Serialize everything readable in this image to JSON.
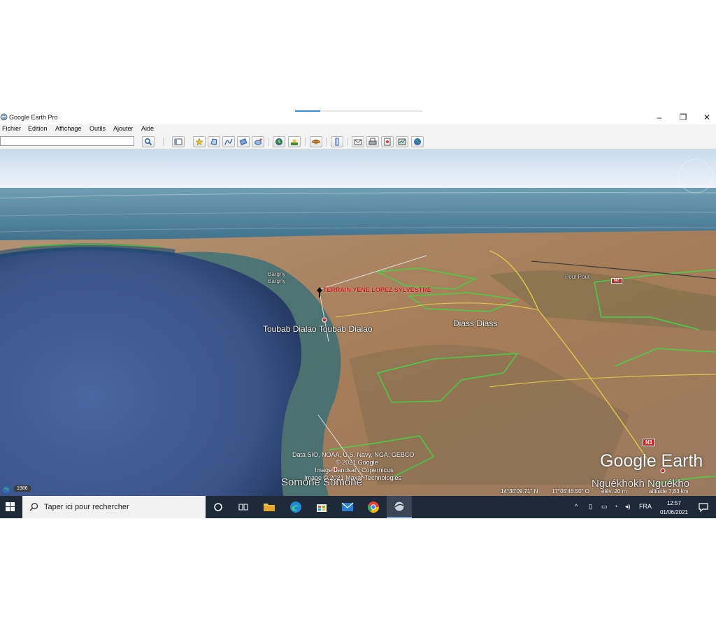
{
  "window": {
    "title": "Google Earth Pro",
    "loading_progress": 0.2,
    "controls": {
      "minimize": "–",
      "restore": "❐",
      "close": "✕"
    }
  },
  "menu": [
    "Fichier",
    "Edition",
    "Affichage",
    "Outils",
    "Ajouter",
    "Aide"
  ],
  "search": {
    "value": ""
  },
  "toolbar_icons": [
    "search-icon",
    "sidebar-toggle-icon",
    "placemark-icon",
    "polygon-icon",
    "path-icon",
    "overlay-icon",
    "record-tour-icon",
    "historical-imagery-icon",
    "sunlight-icon",
    "planets-icon",
    "ruler-icon",
    "email-icon",
    "print-icon",
    "save-image-icon",
    "view-in-maps-icon",
    "earth-icon"
  ],
  "map": {
    "placemark": {
      "label": "TERRAIN YENE LOPEZ SYLVESTRE",
      "color": "#c91616"
    },
    "places": {
      "bargny": "Bargny",
      "bargny2": "Bargny",
      "toubab": "Toubab Dialao  Toubab Dialao",
      "diass": "Diass  Diass",
      "somone": "Somone  Somone",
      "nguekhokh": "Nguékhokh  Nguékho",
      "pout": "Pout  Pout"
    },
    "road_shields": {
      "n1": "N1",
      "n2": "N2"
    },
    "credits": {
      "line1": "Data SIO, NOAA, U.S. Navy, NGA, GEBCO",
      "line2": "© 2021 Google",
      "line3": "Image Landsat / Copernicus",
      "line4": "Image © 2021 Maxar Technologies"
    },
    "brand": "Google Earth",
    "status": {
      "lat": "14°30'09.71\" N",
      "lon": "17°05'46.50\" O",
      "elev": "élév.   20 m",
      "alt": "altitude   7,83 km"
    },
    "imagery_year": "1986"
  },
  "taskbar": {
    "search_placeholder": "Taper ici pour rechercher",
    "apps": [
      "cortana-icon",
      "task-view-icon",
      "file-explorer-icon",
      "edge-icon",
      "store-icon",
      "mail-icon",
      "chrome-icon",
      "google-earth-icon"
    ],
    "tray": {
      "lang": "FRA",
      "time": "12:57",
      "date": "01/06/2021"
    }
  },
  "colors": {
    "ocean": "#3e5d94",
    "sky": "#dce9f2",
    "land": "#a8845f",
    "taskbar": "#1f2a38"
  }
}
